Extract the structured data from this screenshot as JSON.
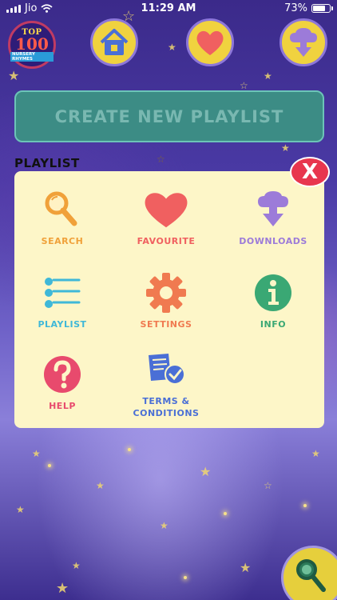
{
  "status_bar": {
    "carrier": "Jio",
    "time": "11:29 AM",
    "battery": "73%",
    "battery_level": 0.73
  },
  "logo": {
    "top": "TOP",
    "number": "100",
    "sub": "NURSERY RHYMES"
  },
  "create_button": {
    "label": "CREATE NEW PLAYLIST"
  },
  "section": {
    "title": "PLAYLIST"
  },
  "menu": {
    "close_label": "X",
    "items": [
      {
        "label": "SEARCH",
        "color": "#f0a13a",
        "icon": "search-icon"
      },
      {
        "label": "FAVOURITE",
        "color": "#f06060",
        "icon": "heart-icon"
      },
      {
        "label": "DOWNLOADS",
        "color": "#9c7bd9",
        "icon": "download-icon"
      },
      {
        "label": "PLAYLIST",
        "color": "#3fb8d8",
        "icon": "list-icon"
      },
      {
        "label": "SETTINGS",
        "color": "#f07a50",
        "icon": "gear-icon"
      },
      {
        "label": "INFO",
        "color": "#3aa874",
        "icon": "info-icon"
      },
      {
        "label": "HELP",
        "color": "#e84a6d",
        "icon": "help-icon"
      },
      {
        "label": "TERMS & CONDITIONS",
        "color": "#4a6fd6",
        "icon": "document-check-icon"
      }
    ]
  }
}
